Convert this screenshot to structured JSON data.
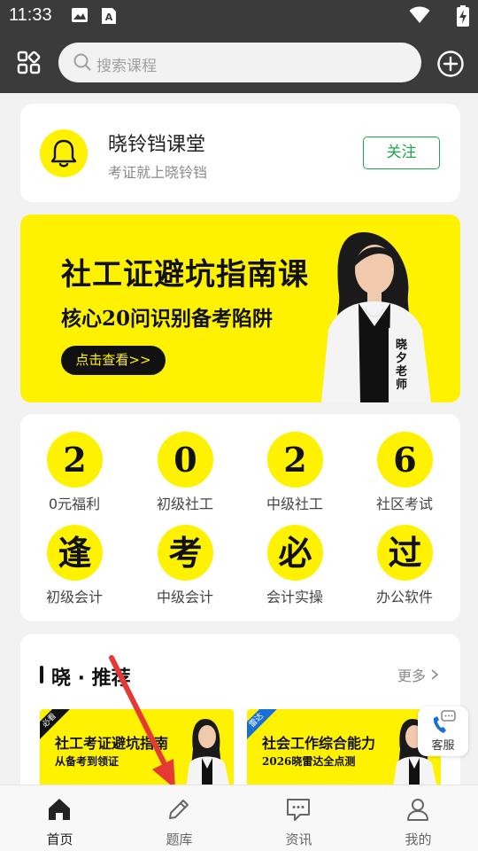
{
  "status_bar": {
    "time": "11:33",
    "icons": [
      "image-icon",
      "font-a-icon",
      "wifi-icon",
      "battery-charging-icon"
    ]
  },
  "header": {
    "search_placeholder": "搜索课程",
    "left_icon": "grid-icon",
    "right_icon": "plus-circle-icon"
  },
  "brand": {
    "name": "晓铃铛课堂",
    "slogan": "考证就上晓铃铛",
    "follow_label": "关注",
    "icon": "bell-icon"
  },
  "banner": {
    "title": "社工证避坑指南课",
    "subtitle": "核心20问识别备考陷阱",
    "cta": "点击查看>>",
    "teacher": "晓夕老师"
  },
  "categories": [
    {
      "glyph": "2",
      "label": "0元福利"
    },
    {
      "glyph": "0",
      "label": "初级社工"
    },
    {
      "glyph": "2",
      "label": "中级社工"
    },
    {
      "glyph": "6",
      "label": "社区考试"
    },
    {
      "glyph": "逢",
      "label": "初级会计"
    },
    {
      "glyph": "考",
      "label": "中级会计"
    },
    {
      "glyph": "必",
      "label": "会计实操"
    },
    {
      "glyph": "过",
      "label": "办公软件"
    }
  ],
  "recommend": {
    "title": "晓 · 推荐",
    "more": "更多",
    "courses": [
      {
        "tag": "必看",
        "title": "社工考证避坑指南",
        "subtitle": "从备考到领证",
        "tag_color": "#111111"
      },
      {
        "tag": "雷达",
        "title": "社会工作综合能力",
        "subtitle": "2026晓雷达全点测",
        "tag_color": "#1a6fd6"
      }
    ]
  },
  "kefu": {
    "label": "客服"
  },
  "tabs": [
    {
      "label": "首页",
      "icon": "home-icon",
      "active": true
    },
    {
      "label": "题库",
      "icon": "pencil-icon",
      "active": false
    },
    {
      "label": "资讯",
      "icon": "message-icon",
      "active": false
    },
    {
      "label": "我的",
      "icon": "user-icon",
      "active": false
    }
  ],
  "colors": {
    "brand_yellow": "#fff200",
    "header_bg": "#3b3b3b",
    "follow_green": "#1fa650",
    "annotation_arrow": "#e53935"
  }
}
